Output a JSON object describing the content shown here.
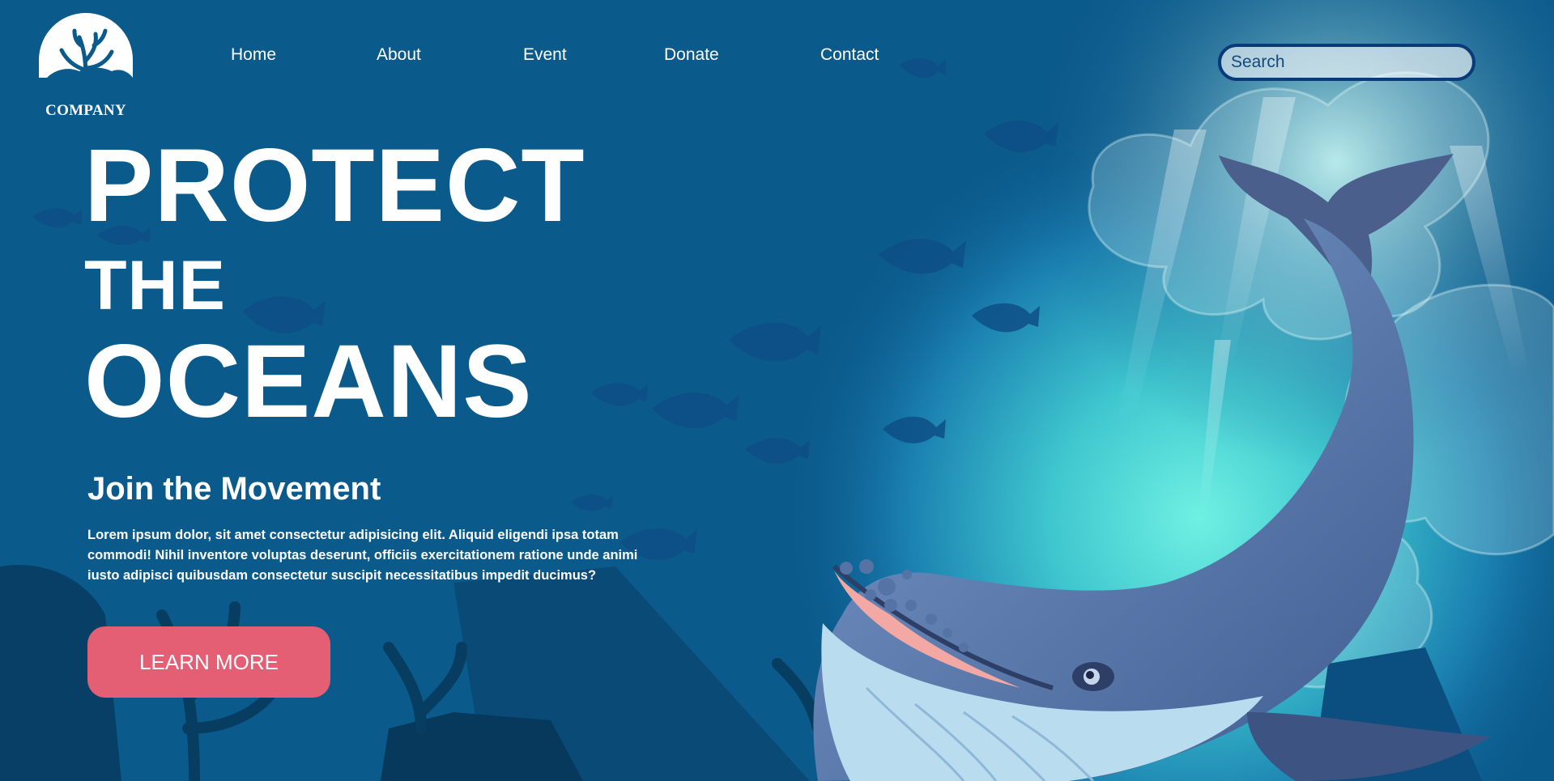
{
  "brand": {
    "name": "COMPANY",
    "logo_icon": "coral-icon"
  },
  "nav": {
    "items": [
      {
        "label": "Home"
      },
      {
        "label": "About"
      },
      {
        "label": "Event"
      },
      {
        "label": "Donate"
      },
      {
        "label": "Contact"
      }
    ]
  },
  "search": {
    "placeholder": "Search",
    "value": ""
  },
  "hero": {
    "line1": "PROTECT",
    "line2": "THE",
    "line3": "OCEANS",
    "subtitle": "Join the Movement",
    "body": "Lorem ipsum dolor, sit amet consectetur adipisicing elit. Aliquid eligendi ipsa totam commodi! Nihil inventore voluptas deserunt, officiis exercitationem ratione unde animi iusto adipisci quibusdam consectetur suscipit necessitatibus impedit ducimus?",
    "cta_label": "LEARN MORE"
  },
  "colors": {
    "background": "#0b5a8c",
    "glow": "#5fe3dc",
    "cta": "#e55f74",
    "search_border": "#0a3a78",
    "whale_body": "#5d7fb0",
    "whale_belly": "#b9dcef",
    "fish_silhouette": "#0d4f86"
  }
}
